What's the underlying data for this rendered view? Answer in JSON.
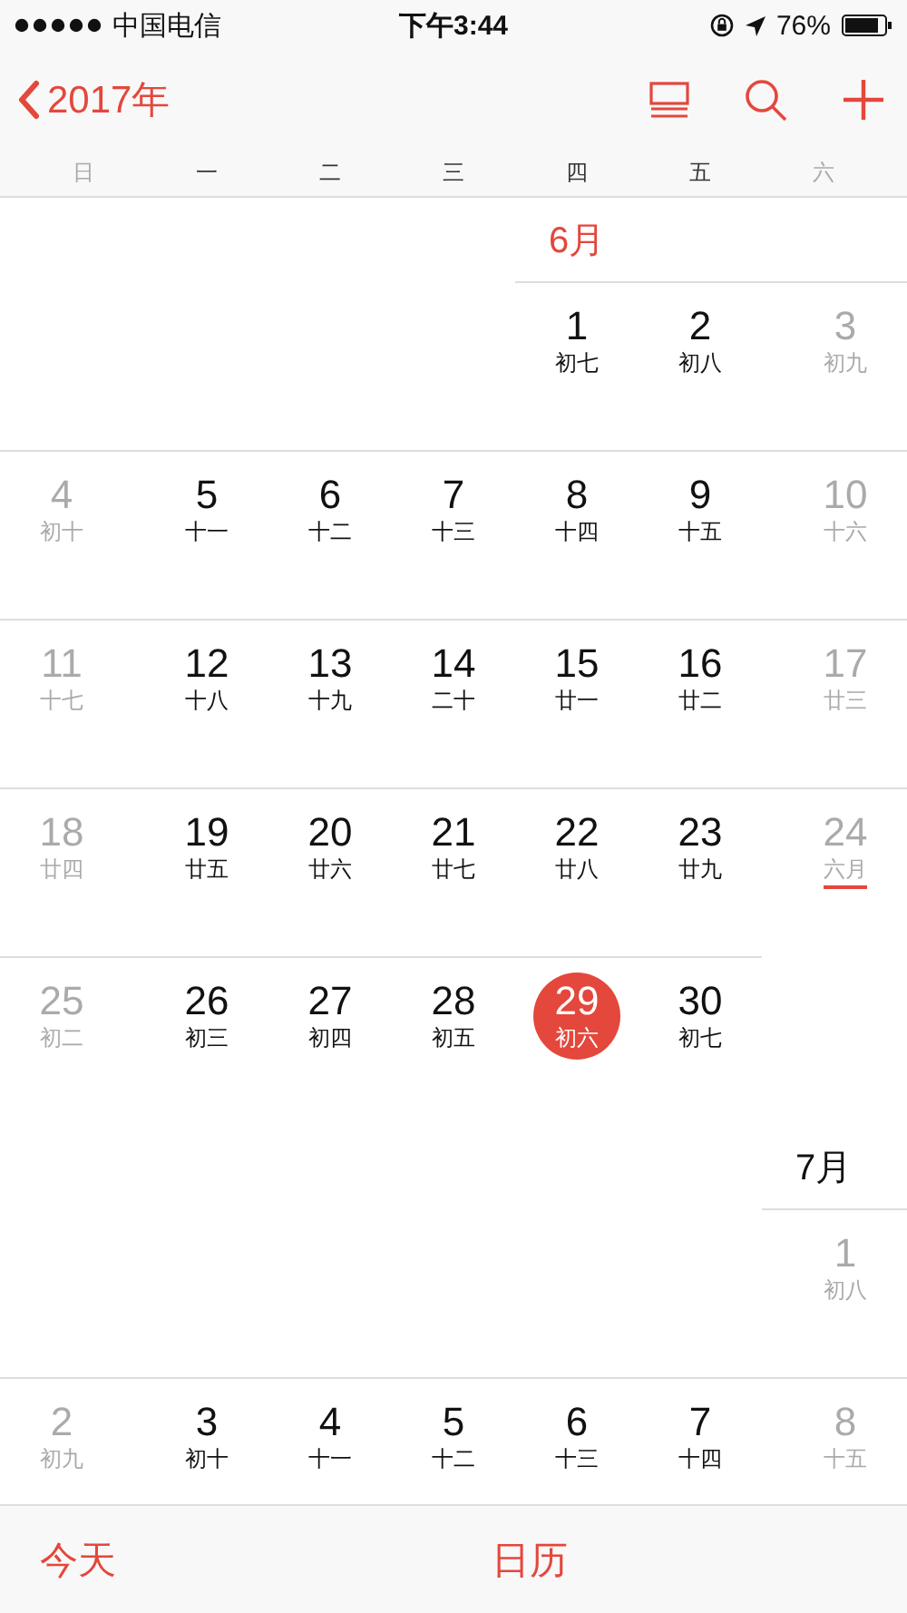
{
  "status_bar": {
    "carrier": "中国电信",
    "time": "下午3:44",
    "battery": "76%"
  },
  "nav": {
    "back": "2017年"
  },
  "weekdays": [
    {
      "label": "日",
      "weekend": true
    },
    {
      "label": "一",
      "weekend": false
    },
    {
      "label": "二",
      "weekend": false
    },
    {
      "label": "三",
      "weekend": false
    },
    {
      "label": "四",
      "weekend": false
    },
    {
      "label": "五",
      "weekend": false
    },
    {
      "label": "六",
      "weekend": true
    }
  ],
  "months": [
    {
      "label": "6月",
      "weeks": [
        [
          {
            "kind": "blank"
          },
          {
            "kind": "blank"
          },
          {
            "kind": "blank"
          },
          {
            "kind": "blank"
          },
          {
            "kind": "day",
            "day": "1",
            "lunar": "初七",
            "weekend": false,
            "today": false,
            "month_start": false
          },
          {
            "kind": "day",
            "day": "2",
            "lunar": "初八",
            "weekend": false,
            "today": false,
            "month_start": false
          },
          {
            "kind": "day",
            "day": "3",
            "lunar": "初九",
            "weekend": true,
            "today": false,
            "month_start": false
          }
        ],
        [
          {
            "kind": "day",
            "day": "4",
            "lunar": "初十",
            "weekend": true,
            "today": false,
            "month_start": false
          },
          {
            "kind": "day",
            "day": "5",
            "lunar": "十一",
            "weekend": false,
            "today": false,
            "month_start": false
          },
          {
            "kind": "day",
            "day": "6",
            "lunar": "十二",
            "weekend": false,
            "today": false,
            "month_start": false
          },
          {
            "kind": "day",
            "day": "7",
            "lunar": "十三",
            "weekend": false,
            "today": false,
            "month_start": false
          },
          {
            "kind": "day",
            "day": "8",
            "lunar": "十四",
            "weekend": false,
            "today": false,
            "month_start": false
          },
          {
            "kind": "day",
            "day": "9",
            "lunar": "十五",
            "weekend": false,
            "today": false,
            "month_start": false
          },
          {
            "kind": "day",
            "day": "10",
            "lunar": "十六",
            "weekend": true,
            "today": false,
            "month_start": false
          }
        ],
        [
          {
            "kind": "day",
            "day": "11",
            "lunar": "十七",
            "weekend": true,
            "today": false,
            "month_start": false
          },
          {
            "kind": "day",
            "day": "12",
            "lunar": "十八",
            "weekend": false,
            "today": false,
            "month_start": false
          },
          {
            "kind": "day",
            "day": "13",
            "lunar": "十九",
            "weekend": false,
            "today": false,
            "month_start": false
          },
          {
            "kind": "day",
            "day": "14",
            "lunar": "二十",
            "weekend": false,
            "today": false,
            "month_start": false
          },
          {
            "kind": "day",
            "day": "15",
            "lunar": "廿一",
            "weekend": false,
            "today": false,
            "month_start": false
          },
          {
            "kind": "day",
            "day": "16",
            "lunar": "廿二",
            "weekend": false,
            "today": false,
            "month_start": false
          },
          {
            "kind": "day",
            "day": "17",
            "lunar": "廿三",
            "weekend": true,
            "today": false,
            "month_start": false
          }
        ],
        [
          {
            "kind": "day",
            "day": "18",
            "lunar": "廿四",
            "weekend": true,
            "today": false,
            "month_start": false
          },
          {
            "kind": "day",
            "day": "19",
            "lunar": "廿五",
            "weekend": false,
            "today": false,
            "month_start": false
          },
          {
            "kind": "day",
            "day": "20",
            "lunar": "廿六",
            "weekend": false,
            "today": false,
            "month_start": false
          },
          {
            "kind": "day",
            "day": "21",
            "lunar": "廿七",
            "weekend": false,
            "today": false,
            "month_start": false
          },
          {
            "kind": "day",
            "day": "22",
            "lunar": "廿八",
            "weekend": false,
            "today": false,
            "month_start": false
          },
          {
            "kind": "day",
            "day": "23",
            "lunar": "廿九",
            "weekend": false,
            "today": false,
            "month_start": false
          },
          {
            "kind": "day",
            "day": "24",
            "lunar": "六月",
            "weekend": true,
            "today": false,
            "month_start": true
          }
        ],
        [
          {
            "kind": "day",
            "day": "25",
            "lunar": "初二",
            "weekend": true,
            "today": false,
            "month_start": false
          },
          {
            "kind": "day",
            "day": "26",
            "lunar": "初三",
            "weekend": false,
            "today": false,
            "month_start": false
          },
          {
            "kind": "day",
            "day": "27",
            "lunar": "初四",
            "weekend": false,
            "today": false,
            "month_start": false
          },
          {
            "kind": "day",
            "day": "28",
            "lunar": "初五",
            "weekend": false,
            "today": false,
            "month_start": false
          },
          {
            "kind": "day",
            "day": "29",
            "lunar": "初六",
            "today": true,
            "month_start": false
          },
          {
            "kind": "day",
            "day": "30",
            "lunar": "初七",
            "weekend": false,
            "today": false,
            "month_start": false
          },
          {
            "kind": "blank"
          }
        ]
      ]
    },
    {
      "label": "7月",
      "weeks": [
        [
          {
            "kind": "blank"
          },
          {
            "kind": "blank"
          },
          {
            "kind": "blank"
          },
          {
            "kind": "blank"
          },
          {
            "kind": "blank"
          },
          {
            "kind": "blank"
          },
          {
            "kind": "day",
            "day": "1",
            "lunar": "初八",
            "weekend": true,
            "today": false,
            "month_start": false
          }
        ],
        [
          {
            "kind": "day",
            "day": "2",
            "lunar": "初九",
            "weekend": true,
            "today": false,
            "month_start": false
          },
          {
            "kind": "day",
            "day": "3",
            "lunar": "初十",
            "weekend": false,
            "today": false,
            "month_start": false
          },
          {
            "kind": "day",
            "day": "4",
            "lunar": "十一",
            "weekend": false,
            "today": false,
            "month_start": false
          },
          {
            "kind": "day",
            "day": "5",
            "lunar": "十二",
            "weekend": false,
            "today": false,
            "month_start": false
          },
          {
            "kind": "day",
            "day": "6",
            "lunar": "十三",
            "weekend": false,
            "today": false,
            "month_start": false
          },
          {
            "kind": "day",
            "day": "7",
            "lunar": "十四",
            "weekend": false,
            "today": false,
            "month_start": false
          },
          {
            "kind": "day",
            "day": "8",
            "lunar": "十五",
            "weekend": true,
            "today": false,
            "month_start": false
          }
        ]
      ]
    }
  ],
  "tab_bar": [
    {
      "label": "今天"
    },
    {
      "label": "日历"
    }
  ]
}
